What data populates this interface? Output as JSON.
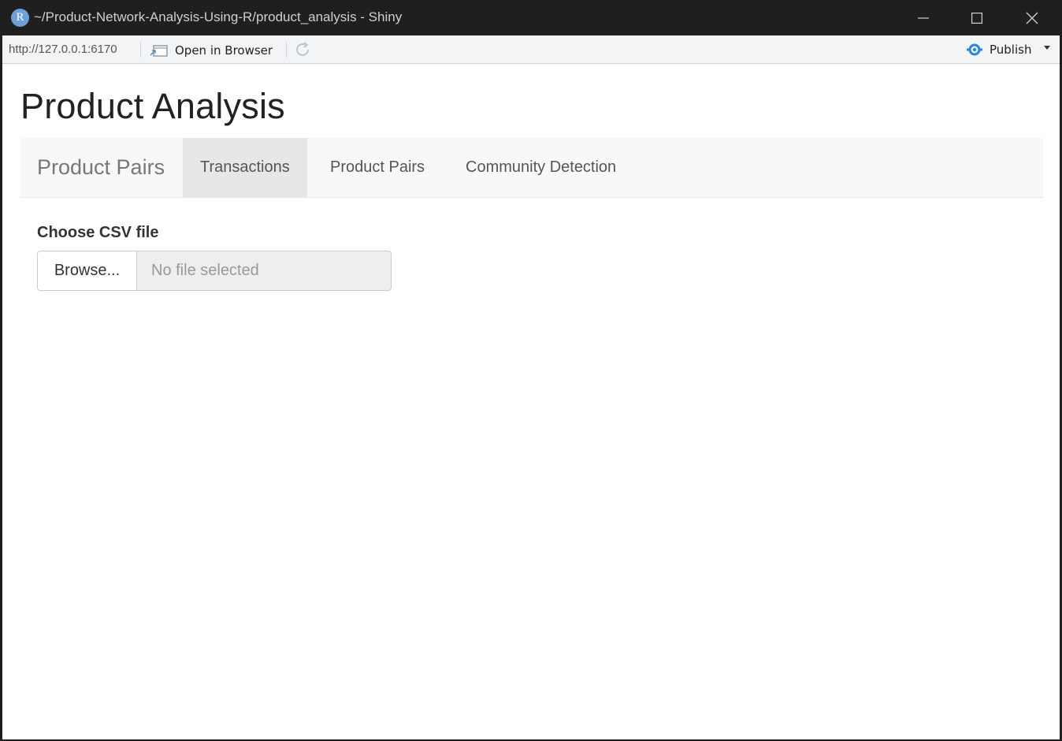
{
  "window": {
    "title": "~/Product-Network-Analysis-Using-R/product_analysis - Shiny",
    "app_icon_letter": "R"
  },
  "toolbar": {
    "url": "http://127.0.0.1:6170",
    "open_in_browser_label": "Open in Browser",
    "publish_label": "Publish",
    "publish_icon_color": "#2a86d6"
  },
  "app": {
    "title": "Product Analysis",
    "navbar": {
      "brand": "Product Pairs",
      "tabs": [
        {
          "label": "Transactions",
          "active": true
        },
        {
          "label": "Product Pairs",
          "active": false
        },
        {
          "label": "Community Detection",
          "active": false
        }
      ]
    },
    "file_input": {
      "label": "Choose CSV file",
      "button_label": "Browse...",
      "placeholder": "No file selected"
    }
  }
}
